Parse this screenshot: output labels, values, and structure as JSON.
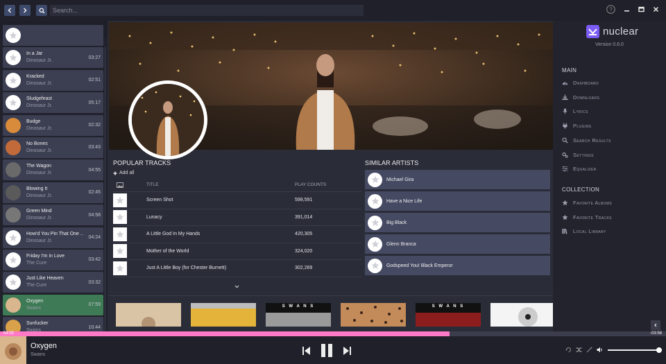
{
  "search": {
    "placeholder": "Search..."
  },
  "queue": {
    "items": [
      {
        "title": "",
        "artist": "",
        "duration": ""
      },
      {
        "title": "In a Jar",
        "artist": "Dinosaur Jr.",
        "duration": "03:27"
      },
      {
        "title": "Kracked",
        "artist": "Dinosaur Jr.",
        "duration": "02:51"
      },
      {
        "title": "Sludgefeast",
        "artist": "Dinosaur Jr.",
        "duration": "05:17"
      },
      {
        "title": "Budge",
        "artist": "Dinosaur Jr.",
        "duration": "02:32"
      },
      {
        "title": "No Bones",
        "artist": "Dinosaur Jr.",
        "duration": "03:43"
      },
      {
        "title": "The Wagon",
        "artist": "Dinosaur Jr.",
        "duration": "04:55"
      },
      {
        "title": "Blowing It",
        "artist": "Dinosaur Jr.",
        "duration": "02:45"
      },
      {
        "title": "Green Mind",
        "artist": "Dinosaur Jr.",
        "duration": "04:58"
      },
      {
        "title": "How'd You Pin That One ...",
        "artist": "Dinosaur Jr.",
        "duration": "04:24"
      },
      {
        "title": "Friday I'm in Love",
        "artist": "The Cure",
        "duration": "03:42"
      },
      {
        "title": "Just Like Heaven",
        "artist": "The Cure",
        "duration": "03:32"
      },
      {
        "title": "Oxygen",
        "artist": "Swans",
        "duration": "07:59"
      },
      {
        "title": "Sunfucker",
        "artist": "Swans",
        "duration": "10:44"
      }
    ]
  },
  "popular": {
    "title": "POPULAR TRACKS",
    "add_all": "Add all",
    "col_title": "TITLE",
    "col_plays": "PLAY COUNTS",
    "tracks": [
      {
        "title": "Screen Shot",
        "plays": "599,591"
      },
      {
        "title": "Lunacy",
        "plays": "391,014"
      },
      {
        "title": "A Little God In My Hands",
        "plays": "420,305"
      },
      {
        "title": "Mother of the World",
        "plays": "324,020"
      },
      {
        "title": "Just A Little Boy (for Chester Burnett)",
        "plays": "302,269"
      }
    ]
  },
  "similar": {
    "title": "SIMILAR ARTISTS",
    "artists": [
      "Michael Gira",
      "Have a Nice Life",
      "Big Black",
      "Glenn Branca",
      "Godspeed You! Black Emperor"
    ]
  },
  "albums": [
    {
      "label": ""
    },
    {
      "label": ""
    },
    {
      "label": "S W A N S"
    },
    {
      "label": ""
    },
    {
      "label": "S W A N S"
    },
    {
      "label": ""
    }
  ],
  "sidebar": {
    "logo": "nuclear",
    "version": "Version 0.6.0",
    "main_title": "MAIN",
    "main_items": [
      {
        "label": "Dashboard",
        "icon": "dashboard-icon"
      },
      {
        "label": "Downloads",
        "icon": "download-icon"
      },
      {
        "label": "Lyrics",
        "icon": "microphone-icon"
      },
      {
        "label": "Plugins",
        "icon": "plug-icon"
      },
      {
        "label": "Search Results",
        "icon": "search-icon"
      },
      {
        "label": "Settings",
        "icon": "cogs-icon"
      },
      {
        "label": "Equalizer",
        "icon": "sliders-icon"
      }
    ],
    "collection_title": "COLLECTION",
    "collection_items": [
      {
        "label": "Favorite Albums",
        "icon": "star-icon"
      },
      {
        "label": "Favorite Tracks",
        "icon": "star-icon"
      },
      {
        "label": "Local Library",
        "icon": "library-icon"
      }
    ]
  },
  "seek": {
    "elapsed": "04:00",
    "remaining": "-03:58",
    "progress": 0.675
  },
  "player": {
    "title": "Oxygen",
    "artist": "Swans",
    "volume": 0.95
  },
  "colors": {
    "accent": "#ff79c6",
    "active_queue": "#3e7a55",
    "brand": "#7b5cf5"
  }
}
